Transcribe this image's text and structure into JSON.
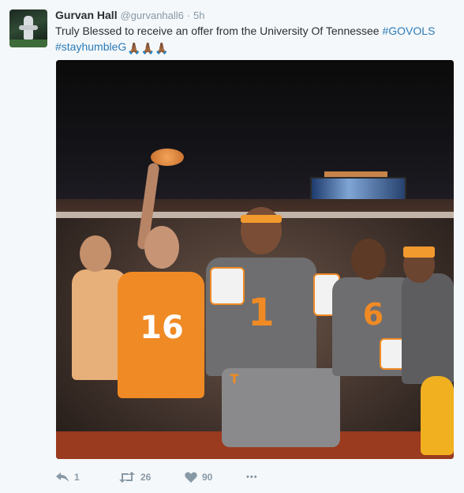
{
  "author": {
    "name": "Gurvan Hall",
    "handle": "@gurvanhall6",
    "separator": "·",
    "time": "5h"
  },
  "tweet": {
    "text_plain": "Truly Blessed to receive an offer from the University Of Tennessee ",
    "hashtag1": "#GOVOLS",
    "hashtag2": "#stayhumbleG",
    "emoji": "🙏🏾🙏🏾🙏🏾"
  },
  "media": {
    "jersey_left_number": "16",
    "jersey_center_number": "1",
    "jersey_right_number": "6",
    "helmet_letter": "T"
  },
  "actions": {
    "reply_count": "1",
    "retweet_count": "26",
    "like_count": "90",
    "more_label": "•••"
  },
  "colors": {
    "accent": "#2b7bb9",
    "muted": "#8899a6",
    "orange": "#f08a24"
  },
  "icons": [
    "reply-icon",
    "retweet-icon",
    "heart-icon",
    "more-icon"
  ]
}
